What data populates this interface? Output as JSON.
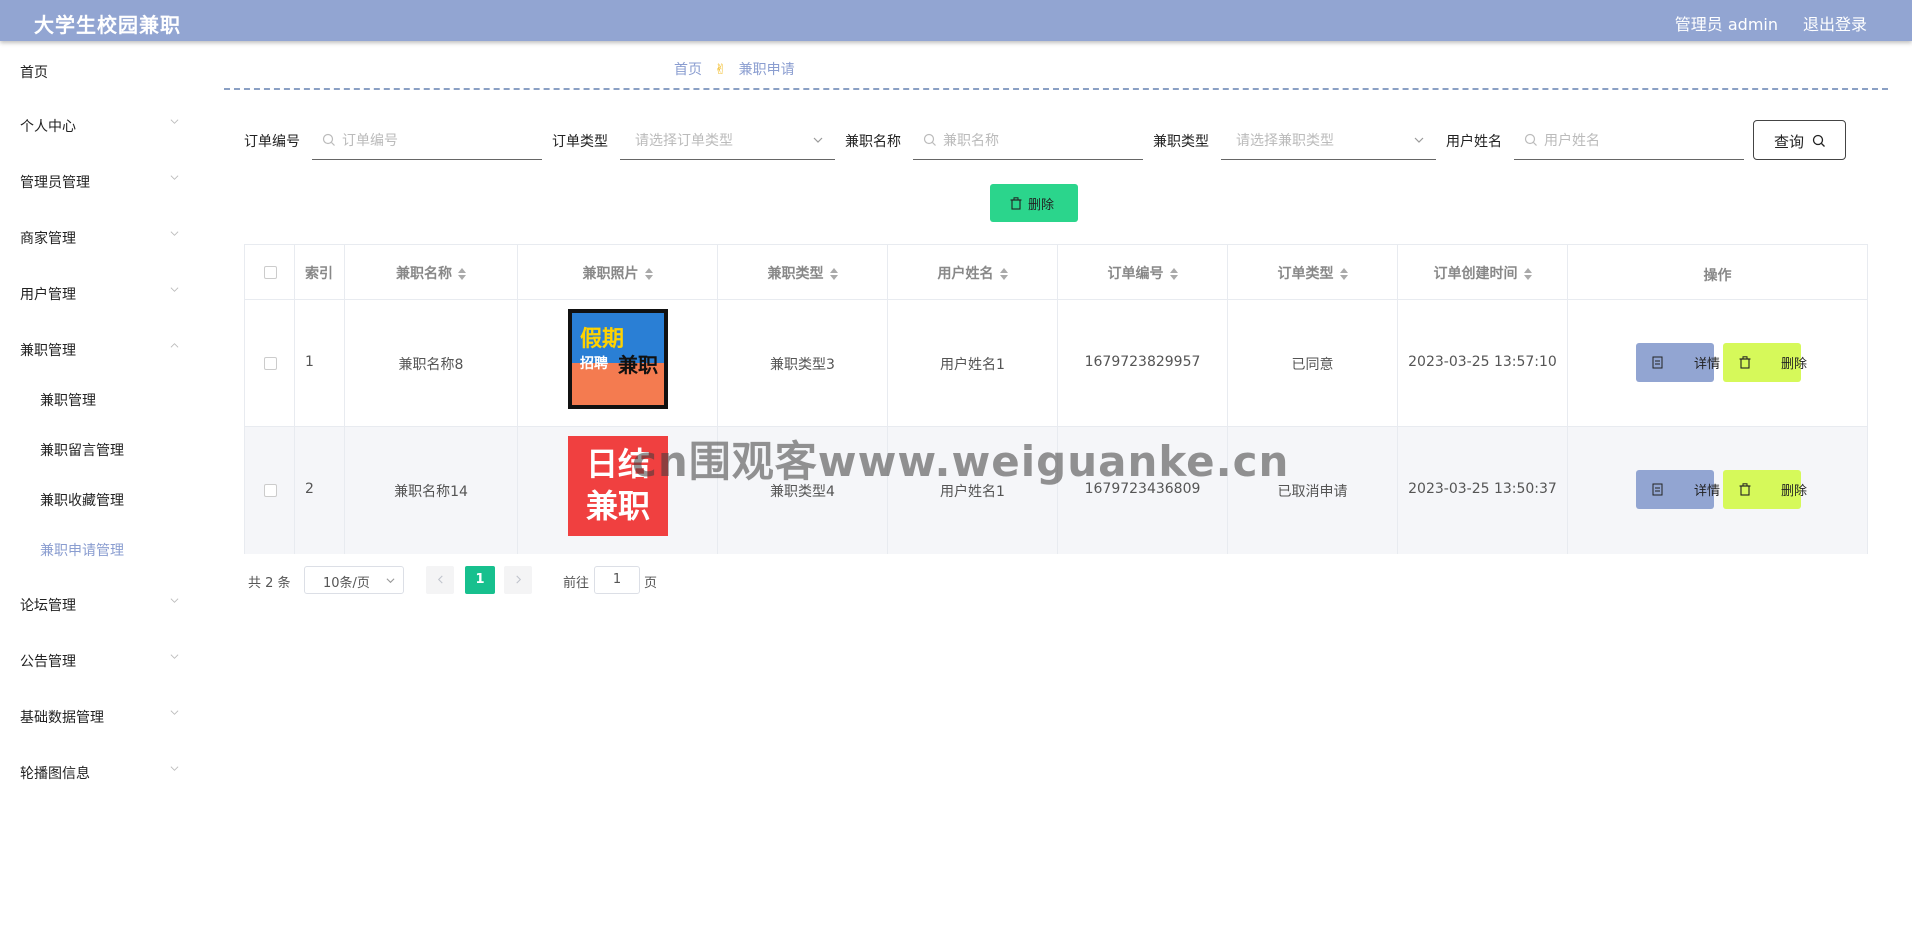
{
  "header": {
    "title": "大学生校园兼职",
    "admin": "管理员 admin",
    "logout": "退出登录"
  },
  "sidebar": {
    "items": [
      {
        "label": "首页"
      },
      {
        "label": "个人中心"
      },
      {
        "label": "管理员管理"
      },
      {
        "label": "商家管理"
      },
      {
        "label": "用户管理"
      },
      {
        "label": "兼职管理"
      },
      {
        "label": "论坛管理"
      },
      {
        "label": "公告管理"
      },
      {
        "label": "基础数据管理"
      },
      {
        "label": "轮播图信息"
      }
    ],
    "sub_items": [
      {
        "label": "兼职管理"
      },
      {
        "label": "兼职留言管理"
      },
      {
        "label": "兼职收藏管理"
      },
      {
        "label": "兼职申请管理"
      }
    ]
  },
  "breadcrumb": {
    "home": "首页",
    "current": "兼职申请"
  },
  "filters": {
    "order_no_label": "订单编号",
    "order_no_placeholder": "订单编号",
    "order_type_label": "订单类型",
    "order_type_placeholder": "请选择订单类型",
    "job_name_label": "兼职名称",
    "job_name_placeholder": "兼职名称",
    "job_type_label": "兼职类型",
    "job_type_placeholder": "请选择兼职类型",
    "user_name_label": "用户姓名",
    "user_name_placeholder": "用户姓名",
    "query": "查询"
  },
  "actions": {
    "delete": "删除"
  },
  "table": {
    "headers": [
      "索引",
      "兼职名称",
      "兼职照片",
      "兼职类型",
      "用户姓名",
      "订单编号",
      "订单类型",
      "订单创建时间",
      "操作"
    ],
    "rows": [
      {
        "index": "1",
        "name": "兼职名称8",
        "image": {
          "title": "假期",
          "subtitle": "招聘",
          "badge": "兼职",
          "accent": "#2a7fd5"
        },
        "type": "兼职类型3",
        "user": "用户姓名1",
        "order_no": "1679723829957",
        "order_type": "已同意",
        "created": "2023-03-25 13:57:10"
      },
      {
        "index": "2",
        "name": "兼职名称14",
        "image": {
          "line1": "日结",
          "line2": "兼职",
          "accent": "#f04040"
        },
        "type": "兼职类型4",
        "user": "用户姓名1",
        "order_no": "1679723436809",
        "order_type": "已取消申请",
        "created": "2023-03-25 13:50:37"
      }
    ],
    "detail_btn": "详情",
    "delete_btn": "删除"
  },
  "pagination": {
    "total": "共 2 条",
    "page_size": "10条/页",
    "current": "1",
    "goto": "前往",
    "goto_value": "1",
    "page_unit": "页"
  },
  "watermark": "cn围观客www.weiguanke.cn",
  "colors": {
    "header": "#92a5d2",
    "primary_green": "#2bd58c",
    "detail": "#92a5d2",
    "delete": "#d6f95a",
    "page_active": "#17c08e"
  }
}
